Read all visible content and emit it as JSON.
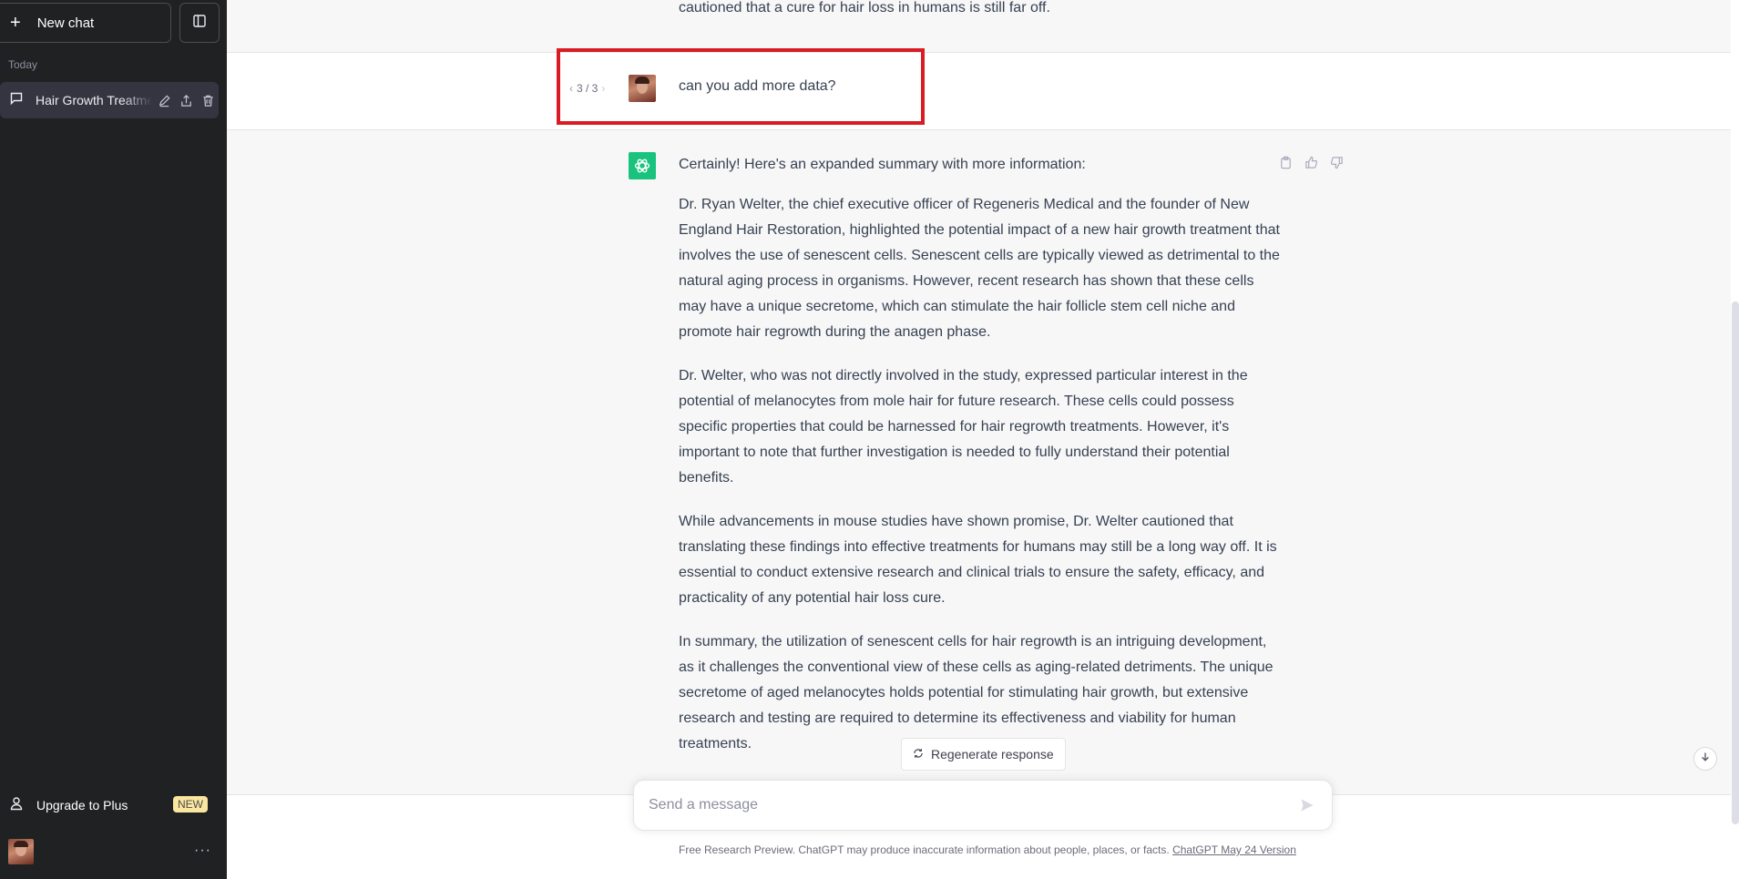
{
  "sidebar": {
    "new_chat_label": "New chat",
    "section_label": "Today",
    "chats": [
      {
        "title": "Hair Growth Treatment"
      }
    ],
    "upgrade_label": "Upgrade to Plus",
    "upgrade_badge": "NEW",
    "more_label": "···"
  },
  "conversation": {
    "previous_message_tail": "cautioned that a cure for hair loss in humans is still far off.",
    "user_message": {
      "pager": "3 / 3",
      "text": "can you add more data?"
    },
    "assistant_message": {
      "paragraphs": [
        "Certainly! Here's an expanded summary with more information:",
        "Dr. Ryan Welter, the chief executive officer of Regeneris Medical and the founder of New England Hair Restoration, highlighted the potential impact of a new hair growth treatment that involves the use of senescent cells. Senescent cells are typically viewed as detrimental to the natural aging process in organisms. However, recent research has shown that these cells may have a unique secretome, which can stimulate the hair follicle stem cell niche and promote hair regrowth during the anagen phase.",
        "Dr. Welter, who was not directly involved in the study, expressed particular interest in the potential of melanocytes from mole hair for future research. These cells could possess specific properties that could be harnessed for hair regrowth treatments. However, it's important to note that further investigation is needed to fully understand their potential benefits.",
        "While advancements in mouse studies have shown promise, Dr. Welter cautioned that translating these findings into effective treatments for humans may still be a long way off. It is essential to conduct extensive research and clinical trials to ensure the safety, efficacy, and practicality of any potential hair loss cure.",
        "In summary, the utilization of senescent cells for hair regrowth is an intriguing development, as it challenges the conventional view of these cells as aging-related detriments. The unique secretome of aged melanocytes holds potential for stimulating hair growth, but extensive research and testing are required to determine its effectiveness and viability for human treatments."
      ]
    }
  },
  "composer": {
    "regenerate_label": "Regenerate response",
    "placeholder": "Send a message",
    "value": ""
  },
  "footer": {
    "note": "Free Research Preview. ChatGPT may produce inaccurate information about people, places, or facts. ",
    "version_link": "ChatGPT May 24 Version"
  },
  "colors": {
    "sidebar_bg": "#202123",
    "accent_green": "#19c37d",
    "highlight_red": "#d91c24",
    "badge_yellow": "#fae69e"
  }
}
